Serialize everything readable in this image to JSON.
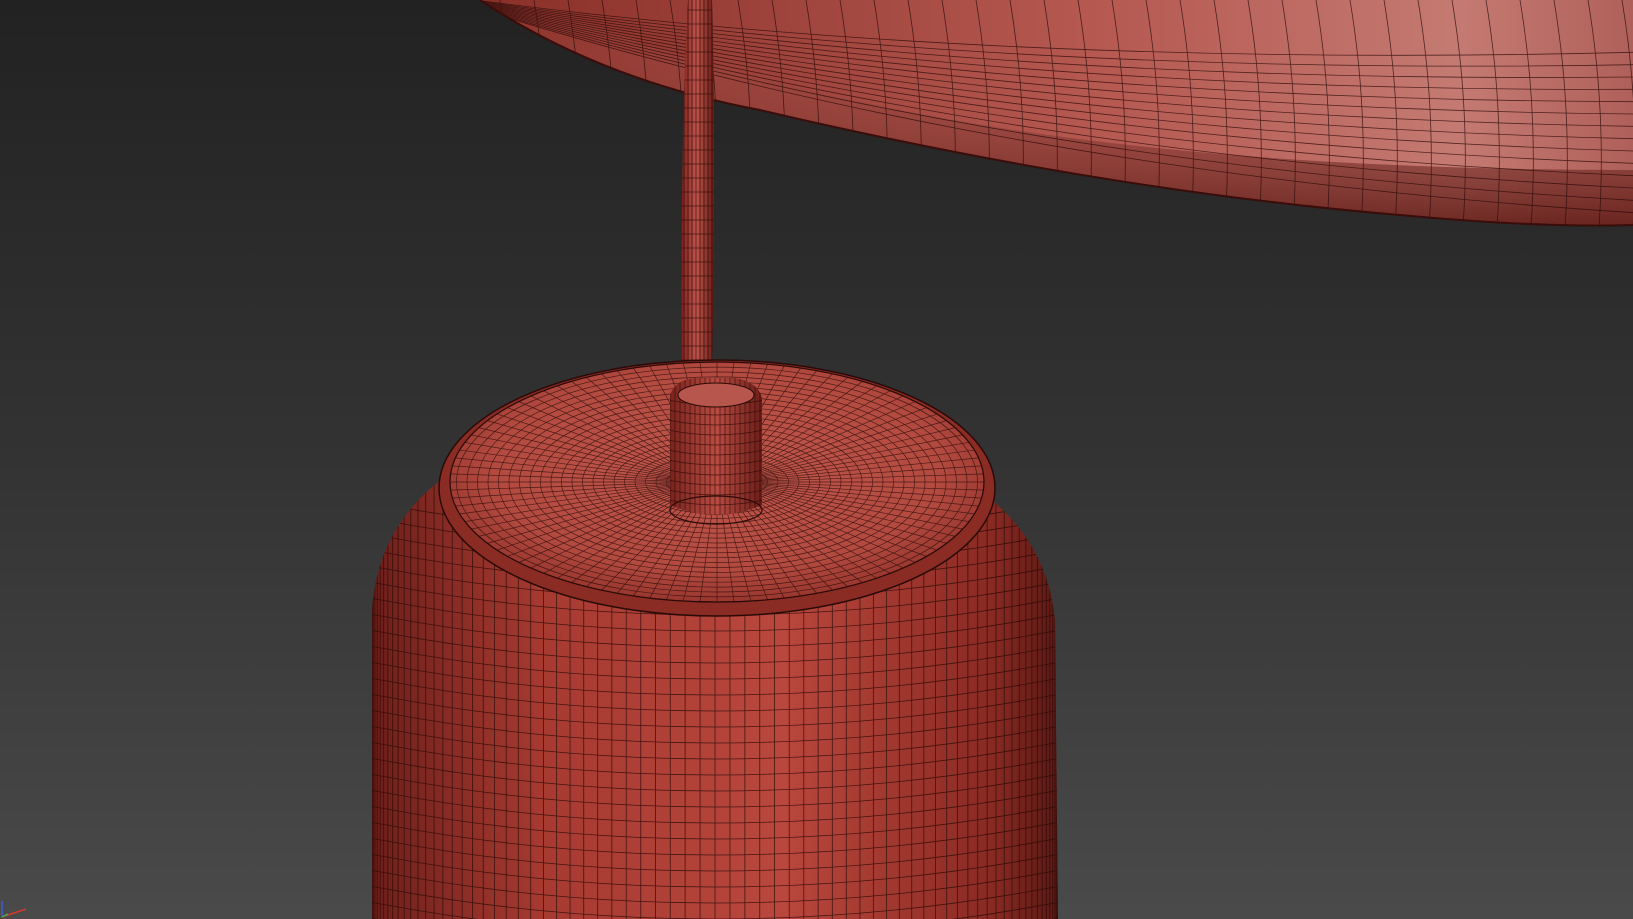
{
  "viewport": {
    "background_top": "#222222",
    "background_bottom": "#4a4a4a",
    "shading": "smooth-with-wireframe-edges"
  },
  "model": {
    "mesh_color": "#b24a42",
    "mesh_color_light": "#c77268",
    "mesh_color_dark": "#6e1f1a",
    "wire_color": "#2a0a08",
    "parts": [
      "lamp-shade",
      "lamp-stem",
      "stem-collar",
      "base-top-cap",
      "base-cylinder"
    ]
  },
  "axis_gizmo": {
    "x_color": "#d33a2c",
    "y_color": "#3fb04a",
    "z_color": "#3a5fd6"
  }
}
